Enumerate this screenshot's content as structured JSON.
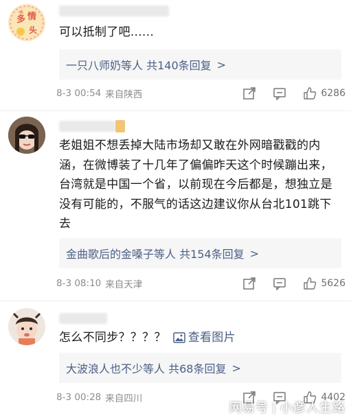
{
  "comments": [
    {
      "text": "可以抵制了吧......",
      "reply_summary": "一只八师奶等人  共140条回复",
      "time": "8-3 00:54",
      "location": "来自陕西",
      "likes": "6286"
    },
    {
      "text": "老姐姐不想丢掉大陆市场却又敢在外网暗戳戳的内涵，在微博装了十几年了偏偏昨天这个时候蹦出来，台湾就是中国一个省，以前现在今后都是，想独立是没有可能的，不服气的话这边建议你从台北101跳下去",
      "reply_summary": "金曲歌后的金嗓子等人  共154条回复",
      "time": "8-3 08:10",
      "location": "来自天津",
      "likes": "5626"
    },
    {
      "text": "怎么不同步？？？？",
      "image_link": "查看图片",
      "reply_summary": "大波浪人也不少等人  共68条回复",
      "time": "8-3 00:28",
      "location": "来自四川",
      "likes": "4402"
    }
  ],
  "watermark": {
    "source": "网易号",
    "author": "小彦人生路"
  },
  "colors": {
    "link": "#4a5f86",
    "meta": "#8c8c8c",
    "reply_bg": "#f6f6f6"
  }
}
